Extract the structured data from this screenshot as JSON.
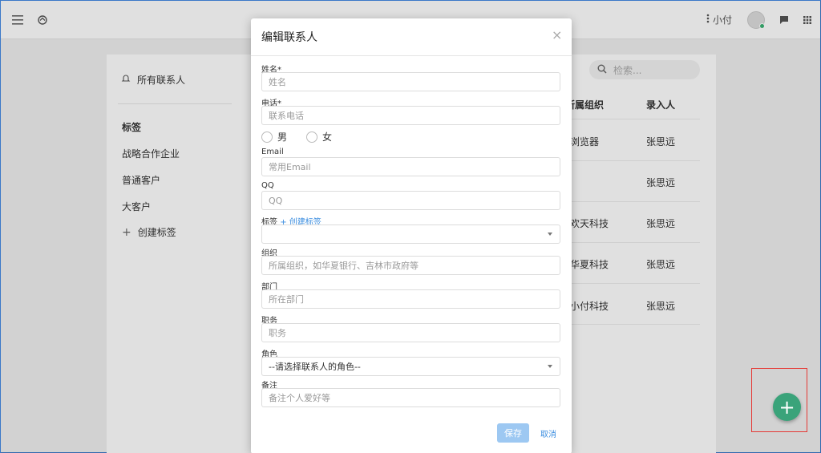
{
  "topbar": {
    "user_name": "小付",
    "icons": [
      "menu-icon",
      "logo-icon",
      "more-vert-icon",
      "chat-icon",
      "apps-grid-icon"
    ]
  },
  "sidebar": {
    "all_contacts": "所有联系人",
    "tags_heading": "标签",
    "tags": [
      "战略合作企业",
      "普通客户",
      "大客户"
    ],
    "create_tag": "创建标签"
  },
  "table": {
    "search_placeholder": "检索...",
    "headers": [
      "所属组织",
      "录入人"
    ],
    "rows": [
      {
        "org": "浏览器",
        "creator": "张思远"
      },
      {
        "org": "",
        "creator": "张思远"
      },
      {
        "org": "欢天科技",
        "creator": "张思远"
      },
      {
        "org": "华夏科技",
        "creator": "张思远"
      },
      {
        "org": "小付科技",
        "creator": "张思远"
      }
    ]
  },
  "modal": {
    "title": "编辑联系人",
    "fields": {
      "name": {
        "label": "姓名*",
        "placeholder": "姓名"
      },
      "phone": {
        "label": "电话*",
        "placeholder": "联系电话"
      },
      "gender": {
        "male": "男",
        "female": "女"
      },
      "email": {
        "label": "Email",
        "placeholder": "常用Email"
      },
      "qq": {
        "label": "QQ",
        "placeholder": "QQ"
      },
      "tags": {
        "label": "标签",
        "create_link": "+ 创建标签",
        "value": ""
      },
      "org": {
        "label": "组织",
        "placeholder": "所属组织，如华夏银行、吉林市政府等"
      },
      "dept": {
        "label": "部门",
        "placeholder": "所在部门"
      },
      "title": {
        "label": "职务",
        "placeholder": "职务"
      },
      "role": {
        "label": "角色",
        "value": "--请选择联系人的角色--"
      },
      "note": {
        "label": "备注",
        "placeholder": "备注个人爱好等"
      }
    },
    "save_label": "保存",
    "cancel_label": "取消"
  },
  "colors": {
    "fab": "#3aa37a",
    "link": "#3b8ee0",
    "save_button": "#9dc8f2",
    "highlight": "#e53935"
  }
}
